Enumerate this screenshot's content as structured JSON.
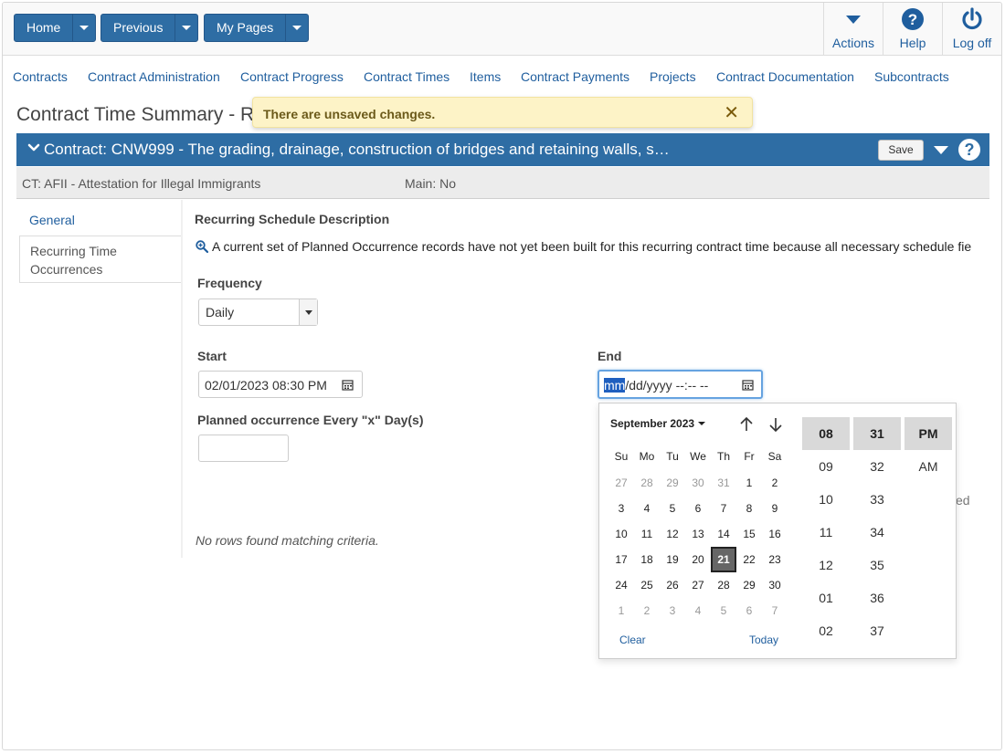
{
  "topbar": {
    "buttons": [
      {
        "label": "Home"
      },
      {
        "label": "Previous"
      },
      {
        "label": "My Pages"
      }
    ],
    "actions": [
      {
        "label": "Actions",
        "icon": "triangle-down-icon"
      },
      {
        "label": "Help",
        "icon": "help-circle-icon"
      },
      {
        "label": "Log off",
        "icon": "power-icon"
      }
    ]
  },
  "nav": [
    {
      "label": "Contracts"
    },
    {
      "label": "Contract Administration"
    },
    {
      "label": "Contract Progress"
    },
    {
      "label": "Contract Times"
    },
    {
      "label": "Items"
    },
    {
      "label": "Contract Payments"
    },
    {
      "label": "Projects"
    },
    {
      "label": "Contract Documentation"
    },
    {
      "label": "Subcontracts"
    }
  ],
  "page": {
    "title": "Contract Time Summary - R",
    "toast": "There are unsaved changes.",
    "toast_close": "✕"
  },
  "contract": {
    "title": "Contract: CNW999 - The grading, drainage, construction of bridges and retaining walls, s…",
    "save_label": "Save",
    "help_label": "?",
    "ct": "CT: AFII - Attestation for Illegal Immigrants",
    "main": "Main: No"
  },
  "tabs": [
    {
      "label": "General"
    },
    {
      "label": "Recurring Time Occurrences"
    }
  ],
  "form": {
    "section_title": "Recurring Schedule Description",
    "info": "A current set of Planned Occurrence records have not yet been built for this recurring contract time because all necessary schedule fie",
    "frequency_label": "Frequency",
    "frequency_value": "Daily",
    "start_label": "Start",
    "start_value": "02/01/2023 08:30  PM",
    "end_label": "End",
    "end_mm": "mm",
    "end_rest": "/dd/yyyy --:-- --",
    "every_label": "Planned occurrence Every \"x\" Day(s)",
    "every_value": "",
    "no_rows": "No rows found matching criteria.",
    "partial_text": "ed"
  },
  "datepicker": {
    "month_label": "September 2023",
    "weekdays": [
      "Su",
      "Mo",
      "Tu",
      "We",
      "Th",
      "Fr",
      "Sa"
    ],
    "weeks": [
      [
        "27",
        "28",
        "29",
        "30",
        "31",
        "1",
        "2"
      ],
      [
        "3",
        "4",
        "5",
        "6",
        "7",
        "8",
        "9"
      ],
      [
        "10",
        "11",
        "12",
        "13",
        "14",
        "15",
        "16"
      ],
      [
        "17",
        "18",
        "19",
        "20",
        "21",
        "22",
        "23"
      ],
      [
        "24",
        "25",
        "26",
        "27",
        "28",
        "29",
        "30"
      ],
      [
        "1",
        "2",
        "3",
        "4",
        "5",
        "6",
        "7"
      ]
    ],
    "selected_day": "21",
    "clear_label": "Clear",
    "today_label": "Today",
    "hours": [
      "08",
      "09",
      "10",
      "11",
      "12",
      "01",
      "02"
    ],
    "minutes": [
      "31",
      "32",
      "33",
      "34",
      "35",
      "36",
      "37"
    ],
    "ampm": [
      "PM",
      "AM"
    ]
  }
}
